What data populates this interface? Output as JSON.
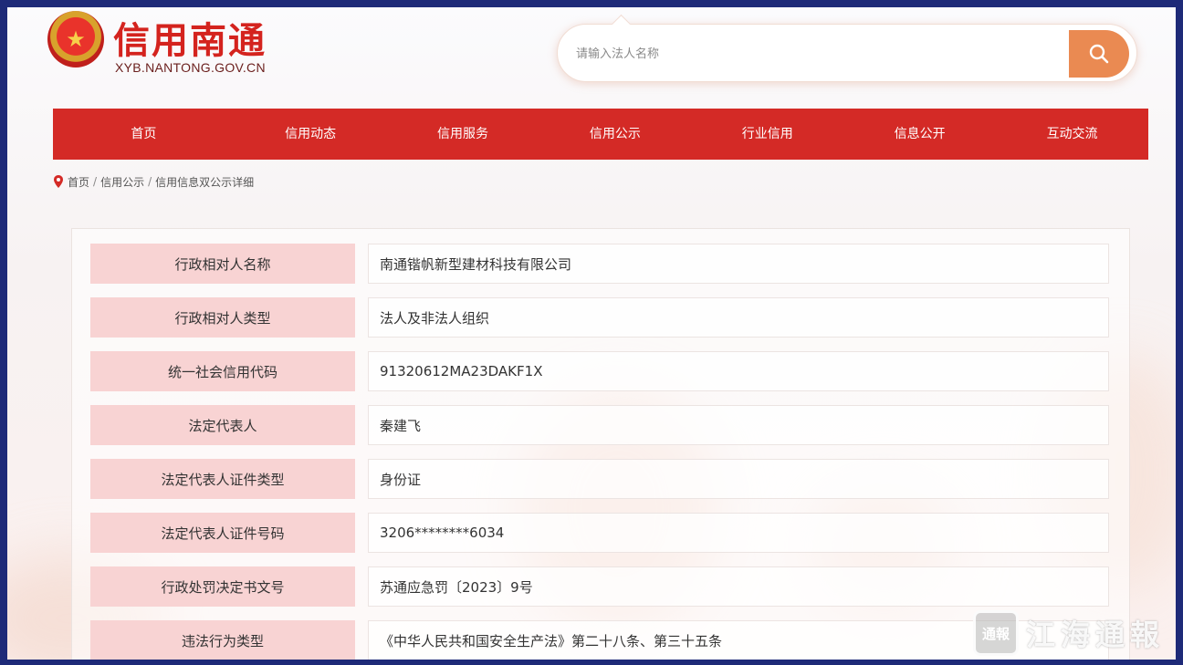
{
  "header": {
    "site_name": "信用南通",
    "site_url": "XYB.NANTONG.GOV.CN"
  },
  "search": {
    "placeholder": "请输入法人名称",
    "button_icon": "search-icon"
  },
  "nav": {
    "items": [
      "首页",
      "信用动态",
      "信用服务",
      "信用公示",
      "行业信用",
      "信息公开",
      "互动交流"
    ]
  },
  "breadcrumb": {
    "items": [
      "首页",
      "信用公示",
      "信用信息双公示详细"
    ]
  },
  "details": {
    "rows": [
      {
        "label": "行政相对人名称",
        "value": "南通锴帆新型建材科技有限公司"
      },
      {
        "label": "行政相对人类型",
        "value": "法人及非法人组织"
      },
      {
        "label": "统一社会信用代码",
        "value": "91320612MA23DAKF1X"
      },
      {
        "label": "法定代表人",
        "value": "秦建飞"
      },
      {
        "label": "法定代表人证件类型",
        "value": "身份证"
      },
      {
        "label": "法定代表人证件号码",
        "value": "3206********6034"
      },
      {
        "label": "行政处罚决定书文号",
        "value": "苏通应急罚〔2023〕9号"
      },
      {
        "label": "违法行为类型",
        "value": "《中华人民共和国安全生产法》第二十八条、第三十五条"
      }
    ]
  },
  "watermark": {
    "badge": "通報",
    "text": "江海通報"
  },
  "colors": {
    "brand_red": "#d42a26",
    "label_bg": "#f8d3d3",
    "search_button": "#ea8a52",
    "frame": "#1e2a78"
  }
}
